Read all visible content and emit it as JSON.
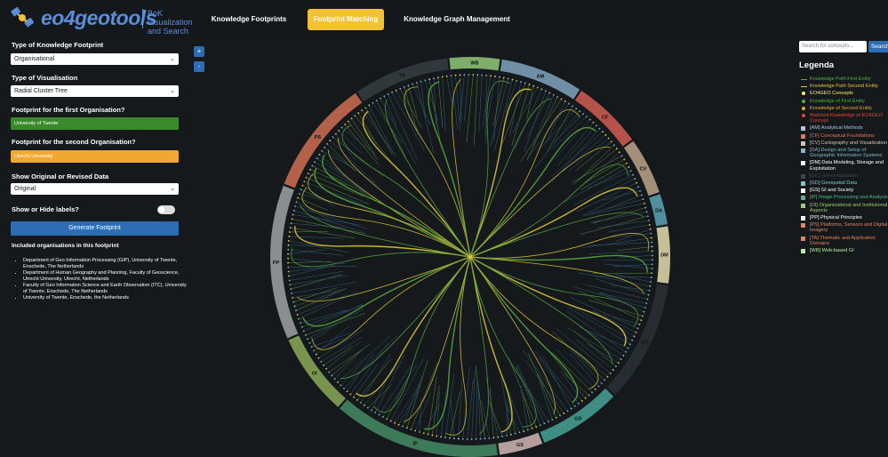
{
  "header": {
    "logo_text": "eo4geotools",
    "logo_subtitle": "BoK Visualization and Search",
    "nav": [
      {
        "label": "Knowledge Footprints",
        "active": false
      },
      {
        "label": "Footprint Matching",
        "active": true
      },
      {
        "label": "Knowledge Graph Management",
        "active": false
      }
    ]
  },
  "sidebar": {
    "type_label": "Type of Knowledge Footprint",
    "type_value": "Organisational",
    "vis_label": "Type of Visualisation",
    "vis_value": "Radial Cluster Tree",
    "first_label": "Footprint for the first Organisation?",
    "first_value": "University of Twente",
    "second_label": "Footprint for the second Organisation?",
    "second_value": "Utrecht University",
    "data_label": "Show Original or Revised Data",
    "data_value": "Original",
    "labels_label": "Show or Hide labels?",
    "generate_label": "Generate Footprint",
    "included_label": "Included organisations in this footprint",
    "organisations": [
      "Department of Geo Information Processing (GIP), University of Twente, Enschede, The Netherlands",
      "Department of Human Geography and Planning, Faculty of Geoscience, Utrecht University, Utrecht, Netherlands",
      "Faculty of Geo Information Science and Earth Observation (ITC), University of Twente, Enschede, The Netherlands",
      "University of Twente, Enschede, the Netherlands"
    ]
  },
  "zoom": {
    "plus": "+",
    "minus": "-"
  },
  "colors": {
    "accent": "#f2c232",
    "first_org": "#3a8a2b",
    "second_org": "#f0a830",
    "button": "#2d6db5"
  },
  "ring": [
    {
      "code": "WB",
      "color": "#7fae6b"
    },
    {
      "code": "AM",
      "color": "#6f8fa6"
    },
    {
      "code": "CF",
      "color": "#b5524a"
    },
    {
      "code": "CV",
      "color": "#a4907a"
    },
    {
      "code": "DA",
      "color": "#4f8fa0"
    },
    {
      "code": "DM",
      "color": "#c7bf98"
    },
    {
      "code": "GC",
      "color": "#262c30"
    },
    {
      "code": "GD",
      "color": "#3f8e83"
    },
    {
      "code": "GS",
      "color": "#b59f9c"
    },
    {
      "code": "IP",
      "color": "#3d7a5a"
    },
    {
      "code": "OI",
      "color": "#78944f"
    },
    {
      "code": "PP",
      "color": "#8a8e90"
    },
    {
      "code": "PS",
      "color": "#b4614a"
    },
    {
      "code": "TA",
      "color": "#31383c"
    }
  ],
  "search": {
    "placeholder": "Search for concepts...",
    "button": "Search"
  },
  "legend": {
    "title": "Legenda",
    "items": [
      {
        "label": "Knowledge Path First Entity",
        "color": "#4bb33c",
        "marker": "line"
      },
      {
        "label": "Knowledge Path Second Entity",
        "color": "#f2c232",
        "marker": "line"
      },
      {
        "label": "EO4GEO Concepts",
        "color": "#fff176",
        "marker": "dot"
      },
      {
        "label": "Knowledge of First Entity",
        "color": "#4bb33c",
        "marker": "dot"
      },
      {
        "label": "Knowledge of Second Entity",
        "color": "#f0a830",
        "marker": "dot"
      },
      {
        "label": "Matched Knowledge of EO4GEO Concept",
        "color": "#e8452f",
        "marker": "dot"
      },
      {
        "label": "[AM] Analytical Methods",
        "color": "#a8c8e0",
        "marker": "sq"
      },
      {
        "label": "[CF] Conceptual Foundations",
        "color": "#e8735f",
        "marker": "sq"
      },
      {
        "label": "[CV] Cartography and Visualization",
        "color": "#d7c6b0",
        "marker": "sq"
      },
      {
        "label": "[DA] Design and Setup of Geographic Information Systems",
        "color": "#7fb8c8",
        "marker": "sq"
      },
      {
        "label": "[DM] Data Modeling, Storage and Exploitation",
        "color": "#ffffff",
        "marker": "sq"
      },
      {
        "label": "[GC] Geocomputation",
        "color": "#3f474c",
        "marker": "sq"
      },
      {
        "label": "[GD] Geospatial Data",
        "color": "#6fd1c3",
        "marker": "sq"
      },
      {
        "label": "[GS] GI and Society",
        "color": "#ffffff",
        "marker": "sq"
      },
      {
        "label": "[IP] Image Processing and Analysis",
        "color": "#58b488",
        "marker": "sq"
      },
      {
        "label": "[OI] Organizational and Institutional Aspects",
        "color": "#9ccc70",
        "marker": "sq"
      },
      {
        "label": "[PP] Physical Principles",
        "color": "#ffffff",
        "marker": "sq"
      },
      {
        "label": "[PS] Platforms, Sensors and Digital Imagery",
        "color": "#e8835f",
        "marker": "sq"
      },
      {
        "label": "[TA] Thematic and Application Domains",
        "color": "#e8835f",
        "marker": "sq"
      },
      {
        "label": "[WB] Web-based GI",
        "color": "#b8f0a0",
        "marker": "sq"
      }
    ]
  }
}
